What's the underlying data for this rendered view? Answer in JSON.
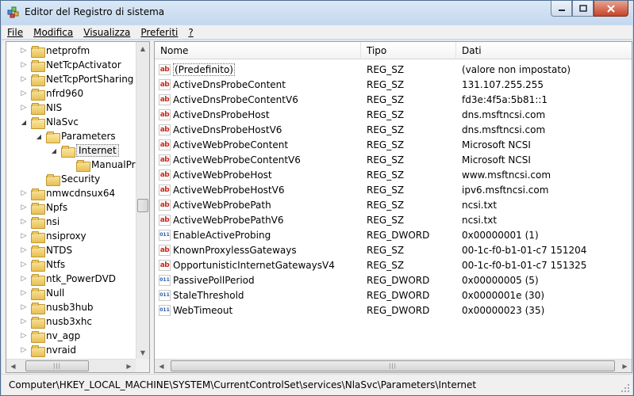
{
  "window": {
    "title": "Editor del Registro di sistema"
  },
  "menu": [
    "File",
    "Modifica",
    "Visualizza",
    "Preferiti",
    "?"
  ],
  "tree": {
    "items": [
      {
        "label": "netprofm",
        "level": 1,
        "expander": "collapsed"
      },
      {
        "label": "NetTcpActivator",
        "level": 1,
        "expander": "collapsed"
      },
      {
        "label": "NetTcpPortSharing",
        "level": 1,
        "expander": "collapsed"
      },
      {
        "label": "nfrd960",
        "level": 1,
        "expander": "collapsed"
      },
      {
        "label": "NIS",
        "level": 1,
        "expander": "collapsed"
      },
      {
        "label": "NlaSvc",
        "level": 1,
        "expander": "expanded"
      },
      {
        "label": "Parameters",
        "level": 2,
        "expander": "expanded"
      },
      {
        "label": "Internet",
        "level": 3,
        "expander": "expanded",
        "selected": true
      },
      {
        "label": "ManualPr",
        "level": 4,
        "expander": "none"
      },
      {
        "label": "Security",
        "level": 2,
        "expander": "none"
      },
      {
        "label": "nmwcdnsux64",
        "level": 1,
        "expander": "collapsed"
      },
      {
        "label": "Npfs",
        "level": 1,
        "expander": "collapsed"
      },
      {
        "label": "nsi",
        "level": 1,
        "expander": "collapsed"
      },
      {
        "label": "nsiproxy",
        "level": 1,
        "expander": "collapsed"
      },
      {
        "label": "NTDS",
        "level": 1,
        "expander": "collapsed"
      },
      {
        "label": "Ntfs",
        "level": 1,
        "expander": "collapsed"
      },
      {
        "label": "ntk_PowerDVD",
        "level": 1,
        "expander": "collapsed"
      },
      {
        "label": "Null",
        "level": 1,
        "expander": "collapsed"
      },
      {
        "label": "nusb3hub",
        "level": 1,
        "expander": "collapsed"
      },
      {
        "label": "nusb3xhc",
        "level": 1,
        "expander": "collapsed"
      },
      {
        "label": "nv_agp",
        "level": 1,
        "expander": "collapsed"
      },
      {
        "label": "nvraid",
        "level": 1,
        "expander": "collapsed"
      }
    ]
  },
  "list": {
    "columns": [
      "Nome",
      "Tipo",
      "Dati"
    ],
    "rows": [
      {
        "name": "(Predefinito)",
        "type": "REG_SZ",
        "data": "(valore non impostato)",
        "icon": "string-value-icon",
        "focused": true
      },
      {
        "name": "ActiveDnsProbeContent",
        "type": "REG_SZ",
        "data": "131.107.255.255",
        "icon": "string-value-icon"
      },
      {
        "name": "ActiveDnsProbeContentV6",
        "type": "REG_SZ",
        "data": "fd3e:4f5a:5b81::1",
        "icon": "string-value-icon"
      },
      {
        "name": "ActiveDnsProbeHost",
        "type": "REG_SZ",
        "data": "dns.msftncsi.com",
        "icon": "string-value-icon"
      },
      {
        "name": "ActiveDnsProbeHostV6",
        "type": "REG_SZ",
        "data": "dns.msftncsi.com",
        "icon": "string-value-icon"
      },
      {
        "name": "ActiveWebProbeContent",
        "type": "REG_SZ",
        "data": "Microsoft NCSI",
        "icon": "string-value-icon"
      },
      {
        "name": "ActiveWebProbeContentV6",
        "type": "REG_SZ",
        "data": "Microsoft NCSI",
        "icon": "string-value-icon"
      },
      {
        "name": "ActiveWebProbeHost",
        "type": "REG_SZ",
        "data": "www.msftncsi.com",
        "icon": "string-value-icon"
      },
      {
        "name": "ActiveWebProbeHostV6",
        "type": "REG_SZ",
        "data": "ipv6.msftncsi.com",
        "icon": "string-value-icon"
      },
      {
        "name": "ActiveWebProbePath",
        "type": "REG_SZ",
        "data": "ncsi.txt",
        "icon": "string-value-icon"
      },
      {
        "name": "ActiveWebProbePathV6",
        "type": "REG_SZ",
        "data": "ncsi.txt",
        "icon": "string-value-icon"
      },
      {
        "name": "EnableActiveProbing",
        "type": "REG_DWORD",
        "data": "0x00000001 (1)",
        "icon": "binary-value-icon"
      },
      {
        "name": "KnownProxylessGateways",
        "type": "REG_SZ",
        "data": "00-1c-f0-b1-01-c7 151204",
        "icon": "string-value-icon"
      },
      {
        "name": "OpportunisticInternetGatewaysV4",
        "type": "REG_SZ",
        "data": "00-1c-f0-b1-01-c7 151325",
        "icon": "string-value-icon"
      },
      {
        "name": "PassivePollPeriod",
        "type": "REG_DWORD",
        "data": "0x00000005 (5)",
        "icon": "binary-value-icon"
      },
      {
        "name": "StaleThreshold",
        "type": "REG_DWORD",
        "data": "0x0000001e (30)",
        "icon": "binary-value-icon"
      },
      {
        "name": "WebTimeout",
        "type": "REG_DWORD",
        "data": "0x00000023 (35)",
        "icon": "binary-value-icon"
      }
    ]
  },
  "status": {
    "path": "Computer\\HKEY_LOCAL_MACHINE\\SYSTEM\\CurrentControlSet\\services\\NlaSvc\\Parameters\\Internet"
  },
  "icons": {
    "string": "ab",
    "dword": "011"
  },
  "colors": {
    "title_bar": "#c4d8ee",
    "close_button": "#c7432a",
    "string_icon": "#c62a1a",
    "dword_icon": "#2b5ca8"
  }
}
